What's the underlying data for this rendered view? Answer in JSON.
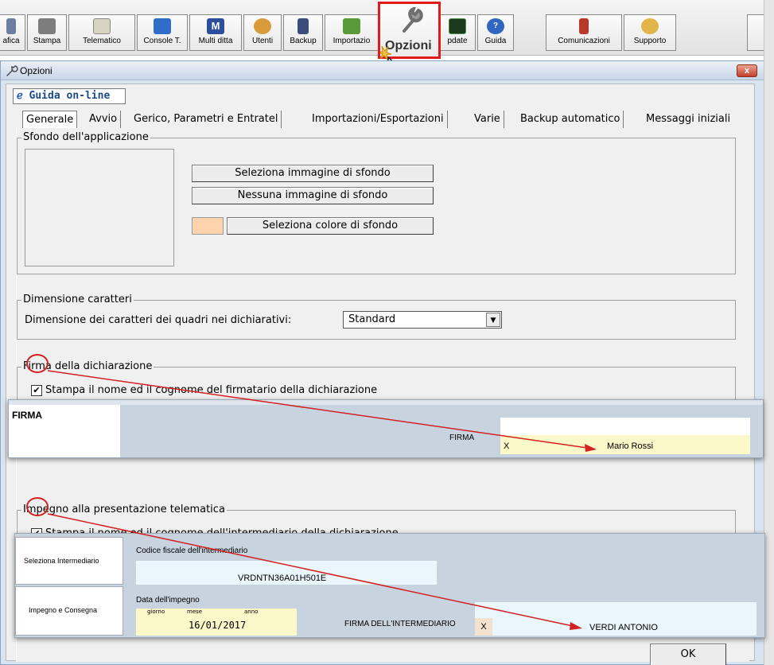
{
  "toolbar": {
    "items": [
      {
        "label": "afica",
        "icon": "chart-icon"
      },
      {
        "label": "Stampa",
        "icon": "printer-icon"
      },
      {
        "label": "Telematico",
        "icon": "telematico-icon"
      },
      {
        "label": "Console T.",
        "icon": "console-icon"
      },
      {
        "label": "Multi ditta",
        "icon": "multi-ditta-icon"
      },
      {
        "label": "Utenti",
        "icon": "users-icon"
      },
      {
        "label": "Backup",
        "icon": "backup-icon"
      },
      {
        "label": "Importazio",
        "icon": "import-icon"
      },
      {
        "label": "Opzioni",
        "icon": "wrench-icon"
      },
      {
        "label": "pdate",
        "icon": "update-icon"
      },
      {
        "label": "Guida",
        "icon": "help-icon"
      },
      {
        "label": "Comunicazioni",
        "icon": "comunicazioni-icon"
      },
      {
        "label": "Supporto",
        "icon": "supporto-icon"
      }
    ]
  },
  "dialog": {
    "title": "Opzioni",
    "close_label": "x",
    "guida_label": "Guida on-line",
    "tabs": [
      {
        "label": "Generale"
      },
      {
        "label": "Avvio"
      },
      {
        "label": "Gerico, Parametri e Entratel"
      },
      {
        "label": "Importazioni/Esportazioni"
      },
      {
        "label": "Varie"
      },
      {
        "label": "Backup automatico"
      },
      {
        "label": "Messaggi iniziali"
      }
    ],
    "sfondo": {
      "legend": "Sfondo dell'applicazione",
      "btn_image": "Seleziona immagine di sfondo",
      "btn_none": "Nessuna immagine di sfondo",
      "btn_color": "Seleziona colore di sfondo",
      "swatch_color": "#fdd3ae"
    },
    "dimensione": {
      "legend": "Dimensione caratteri",
      "label": "Dimensione dei caratteri dei quadri nei dichiarativi:",
      "value": "Standard"
    },
    "firma": {
      "legend": "Firma della dichiarazione",
      "checkbox_label": "Stampa il nome ed il cognome del firmatario della dichiarazione",
      "checked": true
    },
    "impegno": {
      "legend": "Impegno alla presentazione telematica",
      "checkbox_label": "Stampa il nome ed il cognome dell'intermediario della dichiarazione",
      "checked": true
    },
    "ok_label": "OK"
  },
  "firma_panel": {
    "title": "FIRMA",
    "field_label": "FIRMA",
    "x_mark": "X",
    "name": "Mario Rossi"
  },
  "intermediario_panel": {
    "btn_select": "Seleziona Intermediario",
    "btn_impegno": "Impegno e Consegna",
    "cf_label": "Codice fiscale dell'intermediario",
    "cf_value": "VRDNTN36A01H501E",
    "data_label": "Data dell'impegno",
    "giorno": "giorno",
    "mese": "mese",
    "anno": "anno",
    "date_value": "16/01/2017",
    "firma_label": "FIRMA DELL'INTERMEDIARIO",
    "x_mark": "X",
    "name": "VERDI ANTONIO"
  },
  "colors": {
    "highlight": "#e01b1b",
    "panel_blue": "#c8d3e0",
    "field_yellow": "#fbf8c9",
    "field_cyan": "#e9f6fb"
  }
}
